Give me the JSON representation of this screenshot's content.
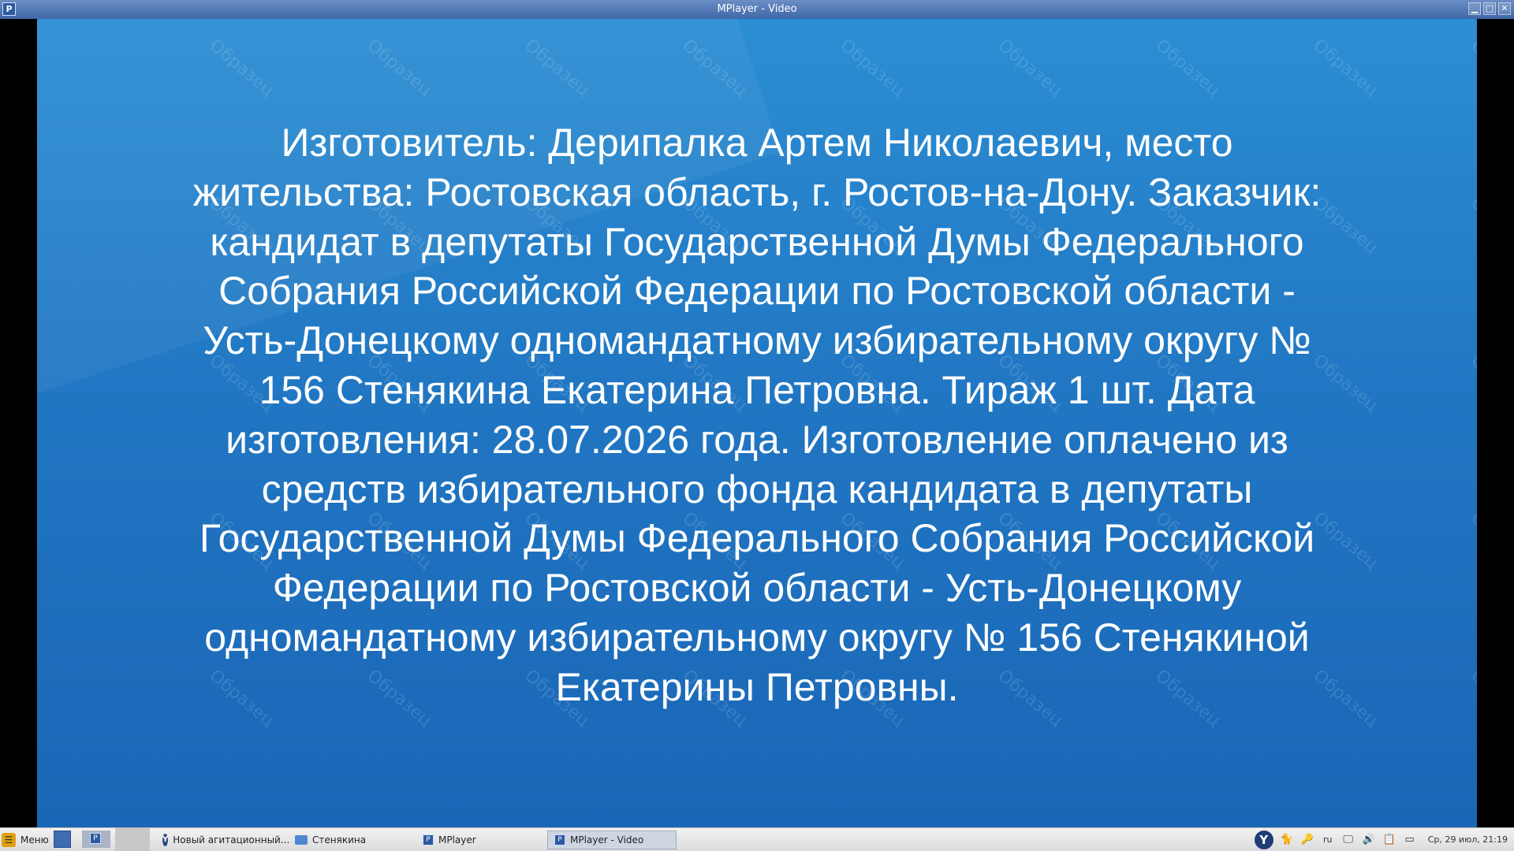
{
  "window": {
    "title": "MPlayer - Video",
    "icon": "mplayer-icon",
    "controls": {
      "minimize": "▁",
      "maximize": "□",
      "close": "✕"
    }
  },
  "video": {
    "watermark_text": "Образец",
    "caption_lines": [
      "Изготовитель: Дерипалка Артем Николаевич, место",
      "жительства: Ростовская область, г. Ростов-на-Дону. Заказчик:",
      "кандидат в депутаты Государственной Думы Федерального",
      "Собрания Российской Федерации по Ростовской области -",
      "Усть-Донецкому одномандатному избирательному округу №",
      "156 Стенякина Екатерина Петровна. Тираж 1 шт. Дата",
      "изготовления: 28.07.2026 года. Изготовление оплачено из",
      "средств избирательного фонда кандидата в депутаты",
      "Государственной Думы Федерального Собрания Российской",
      "Федерации по Ростовской области - Усть-Донецкому",
      "одномандатному избирательному округу № 156 Стенякиной",
      "Екатерины Петровны."
    ]
  },
  "taskbar": {
    "menu_label": "Меню",
    "tasks": [
      {
        "label": "Новый агитационный...",
        "icon": "yandex-browser-icon"
      },
      {
        "label": "Стенякина",
        "icon": "folder-icon"
      },
      {
        "label": "MPlayer",
        "icon": "mplayer-icon"
      },
      {
        "label": "MPlayer - Video",
        "icon": "mplayer-icon",
        "active": true
      }
    ],
    "tray": {
      "language": "ru",
      "clock": "Ср, 29 июл, 21:19"
    }
  }
}
